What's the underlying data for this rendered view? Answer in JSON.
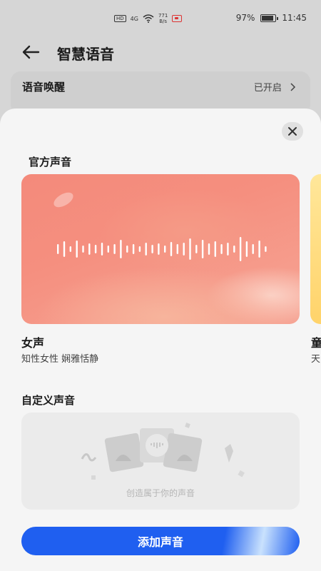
{
  "status_bar": {
    "hd": "HD",
    "signal": "4G",
    "net_speed": "771",
    "net_unit": "B/s",
    "battery": "97%",
    "battery_level": 0.97,
    "time": "11:45"
  },
  "header": {
    "title": "智慧语音",
    "back_icon": "arrow-left-icon"
  },
  "wake": {
    "label": "语音唤醒",
    "status": "已开启",
    "chevron_icon": "chevron-right-icon"
  },
  "sheet": {
    "close_icon": "close-icon",
    "official_title": "官方声音",
    "voices": [
      {
        "name": "女声",
        "description": "知性女性 娴雅恬静"
      },
      {
        "name": "童",
        "description": "天"
      }
    ],
    "custom_title": "自定义声音",
    "custom_hint": "创造属于你的声音",
    "add_button": "添加声音"
  },
  "colors": {
    "accent": "#1f5ff0",
    "card_pink": "#f48a7b",
    "card_yellow": "#ffd36a"
  }
}
